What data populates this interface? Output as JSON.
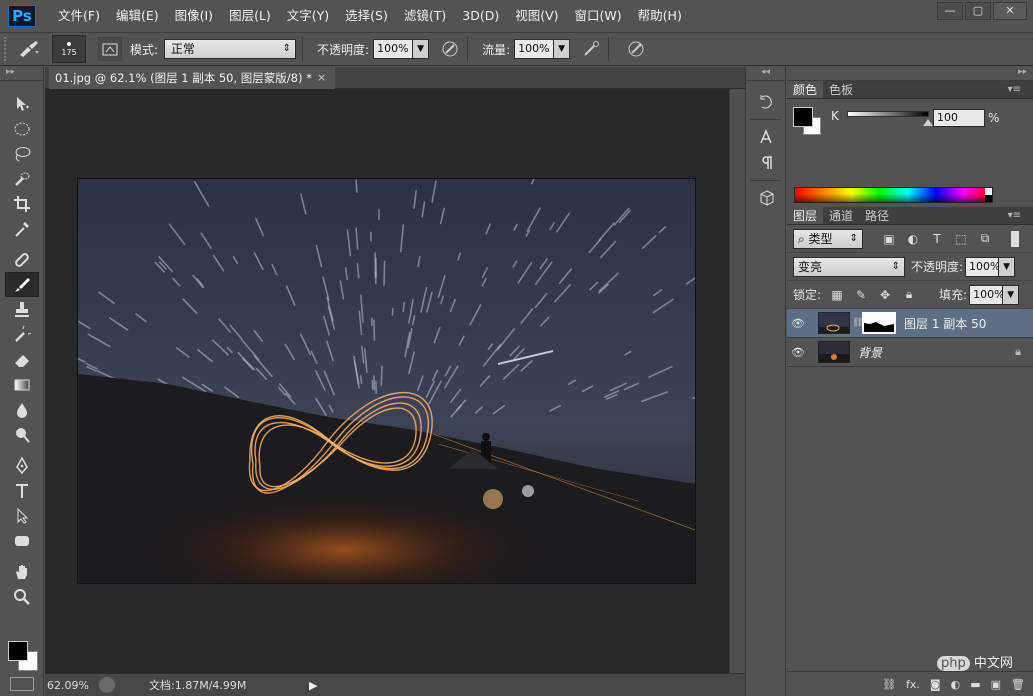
{
  "app": {
    "logo": "Ps"
  },
  "menu": [
    "文件(F)",
    "编辑(E)",
    "图像(I)",
    "图层(L)",
    "文字(Y)",
    "选择(S)",
    "滤镜(T)",
    "3D(D)",
    "视图(V)",
    "窗口(W)",
    "帮助(H)"
  ],
  "window_controls": {
    "minimize": "—",
    "maximize": "▢",
    "close": "✕"
  },
  "options": {
    "brush_size": "175",
    "mode_label": "模式:",
    "mode_value": "正常",
    "opacity_label": "不透明度:",
    "opacity_value": "100%",
    "flow_label": "流量:",
    "flow_value": "100%"
  },
  "document": {
    "tab_title": "01.jpg @ 62.1% (图层 1 副本 50, 图层蒙版/8) *",
    "tab_close": "×"
  },
  "status": {
    "zoom": "62.09%",
    "doc_info": "文档:1.87M/4.99M",
    "arrow": "▶"
  },
  "color_panel": {
    "tabs": [
      "颜色",
      "色板"
    ],
    "channel": "K",
    "value": "100",
    "unit": "%",
    "foreground": "#000000",
    "background": "#ffffff"
  },
  "layers_panel": {
    "tabs": [
      "图层",
      "通道",
      "路径"
    ],
    "filter_kind": "类型",
    "blend_mode": "变亮",
    "opacity_label": "不透明度:",
    "opacity_value": "100%",
    "lock_label": "锁定:",
    "fill_label": "填充:",
    "fill_value": "100%",
    "layers": [
      {
        "name": "图层 1 副本 50",
        "selected": true,
        "has_mask": true
      },
      {
        "name": "背景",
        "selected": false,
        "locked": true
      }
    ],
    "footer_icons": [
      "link-icon",
      "fx-icon",
      "mask-icon",
      "adjustment-icon",
      "group-icon",
      "new-layer-icon",
      "trash-icon"
    ],
    "footer_fx": "fx."
  },
  "watermark": {
    "badge": "php",
    "text": "中文网"
  },
  "colors": {
    "accent": "#31a8ff",
    "selected_layer": "#5d6f84",
    "panel_bg": "#535353"
  }
}
